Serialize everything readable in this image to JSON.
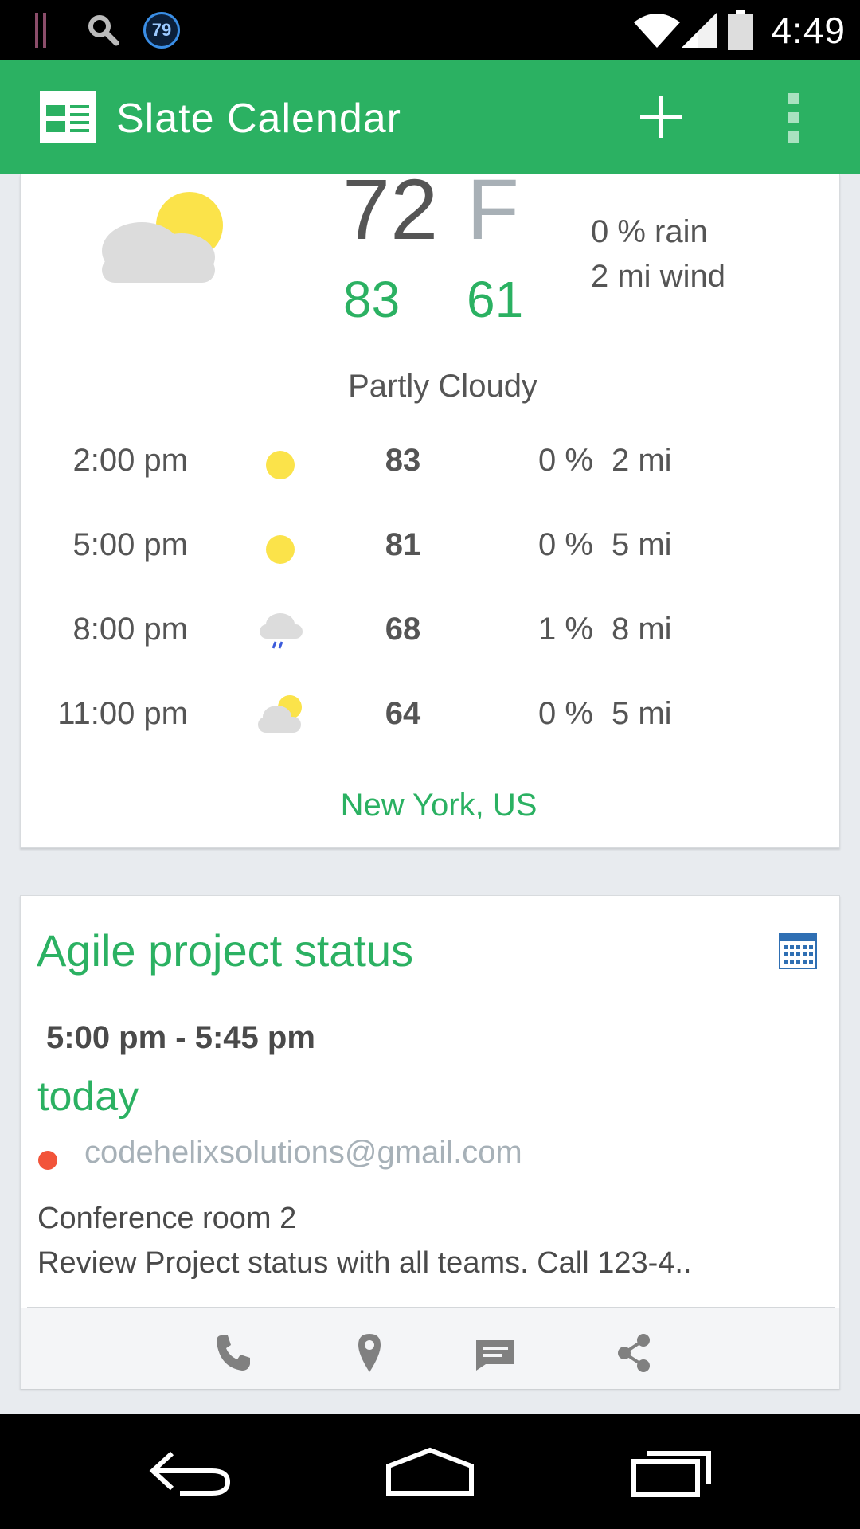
{
  "status_bar": {
    "time": "4:49",
    "notification_badge": "79",
    "icons": [
      "notification-bars-icon",
      "search-icon",
      "badge-icon",
      "wifi-icon",
      "signal-icon",
      "battery-icon"
    ]
  },
  "app_bar": {
    "title": "Slate Calendar",
    "icons": [
      "calendar-list-icon",
      "add-icon",
      "overflow-menu-icon"
    ],
    "color": "#2bb162"
  },
  "weather": {
    "current_temp": "72",
    "unit": "F",
    "high": "83",
    "low": "61",
    "rain": "0 % rain",
    "wind": "2 mi wind",
    "condition": "Partly Cloudy",
    "current_icon": "partly-cloudy-icon",
    "hourly": [
      {
        "time": "2:00 pm",
        "icon": "sun-icon",
        "temp": "83",
        "rain": "0 %",
        "wind": "2 mi"
      },
      {
        "time": "5:00 pm",
        "icon": "sun-icon",
        "temp": "81",
        "rain": "0 %",
        "wind": "5 mi"
      },
      {
        "time": "8:00 pm",
        "icon": "rain-cloud-icon",
        "temp": "68",
        "rain": "1 %",
        "wind": "8 mi"
      },
      {
        "time": "11:00 pm",
        "icon": "partly-cloudy-icon",
        "temp": "64",
        "rain": "0 %",
        "wind": "5 mi"
      }
    ],
    "location": "New York,  US"
  },
  "event": {
    "title": "Agile project status",
    "time_range": "5:00 pm -  5:45 pm",
    "day": "today",
    "account": "codehelixsolutions@gmail.com",
    "account_color": "#f2543a",
    "location": "Conference room 2",
    "description": "Review Project status with all teams.  Call  123-4..",
    "actions": [
      "phone-icon",
      "location-pin-icon",
      "message-icon",
      "share-icon"
    ]
  },
  "nav_bar": {
    "buttons": [
      "back-icon",
      "home-icon",
      "recent-apps-icon"
    ]
  }
}
